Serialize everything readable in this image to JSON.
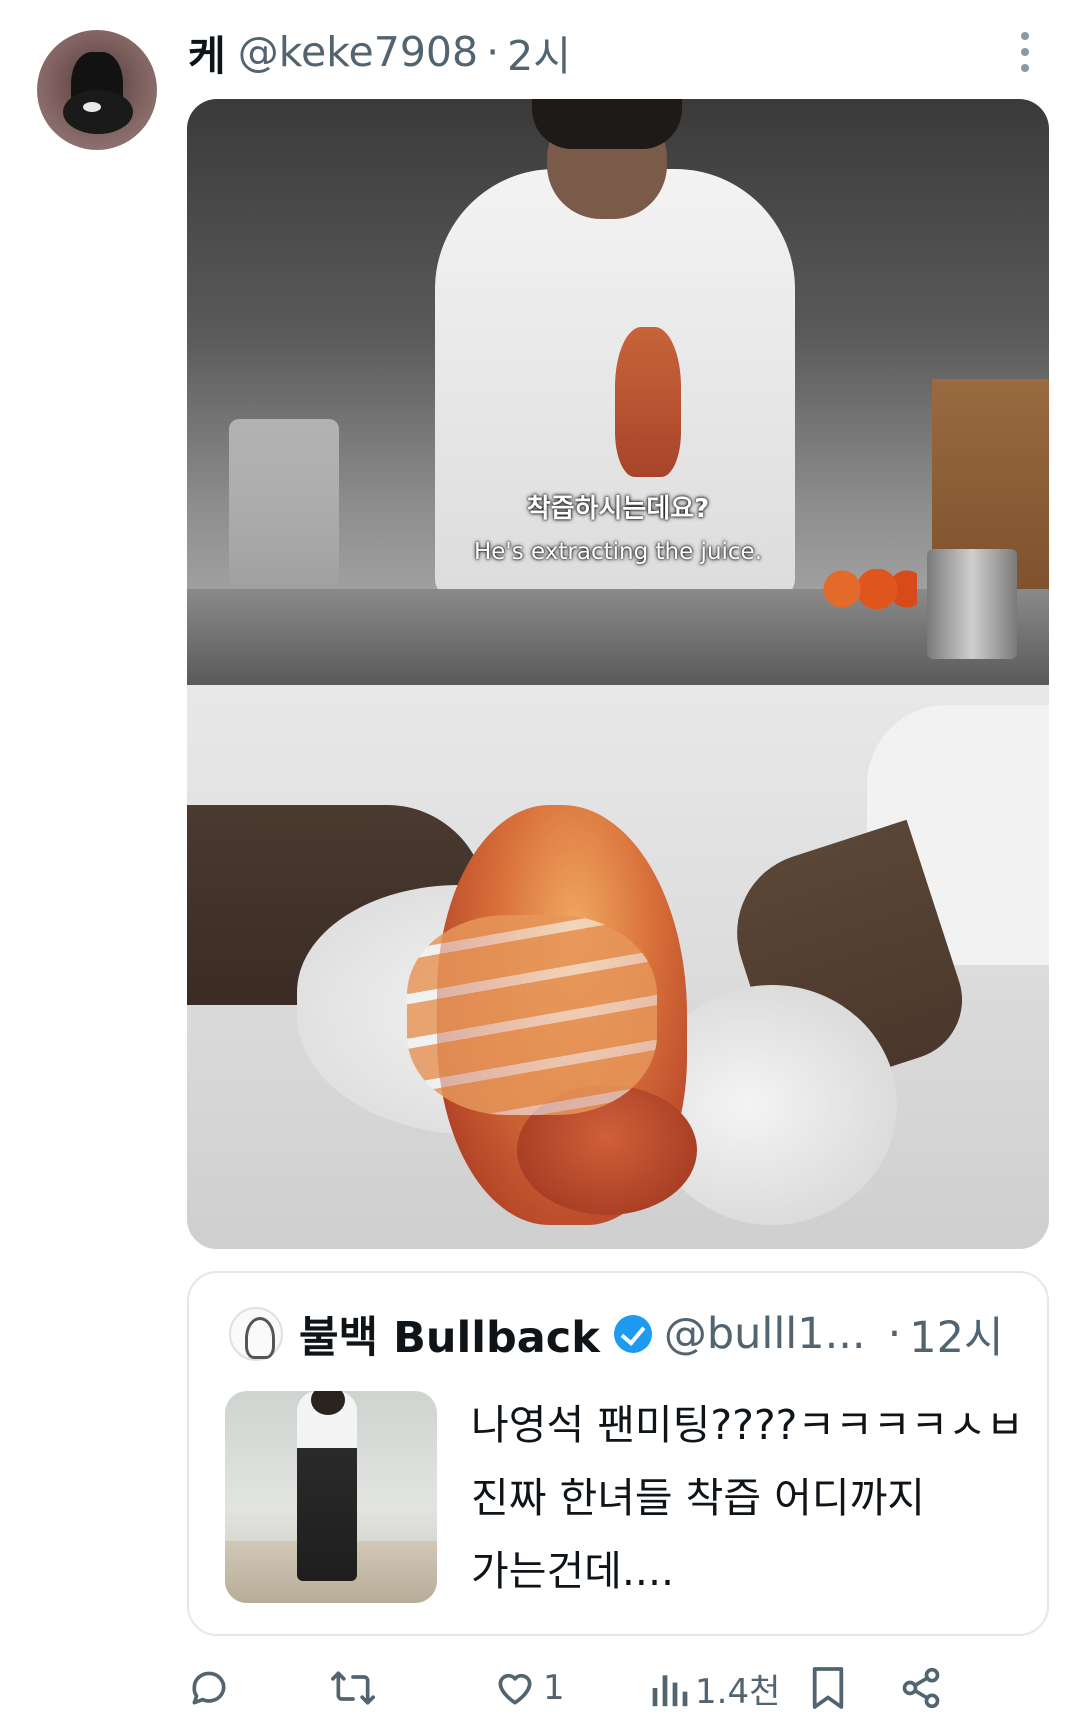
{
  "tweet": {
    "display_name": "케",
    "handle": "@keke7908",
    "separator": "·",
    "time": "2시",
    "avatar_icon": "avatar-image",
    "more_icon": "more-vertical-icon",
    "media": {
      "subtitle_ko": "착즙하시는데요?",
      "subtitle_en": "He's extracting the juice."
    }
  },
  "quote": {
    "display_name": "불백 Bullback",
    "verified_icon": "verified-badge-icon",
    "handle": "@bulll1...",
    "separator": "·",
    "time": "12시",
    "text": "나영석 팬미팅????ㅋㅋㅋㅋㅅㅂ\n진짜 한녀들 착즙 어디까지\n가는건데....",
    "accent_color": "#1d9bf0"
  },
  "actions": {
    "reply": {
      "icon": "reply-icon",
      "count": ""
    },
    "retweet": {
      "icon": "retweet-icon",
      "count": ""
    },
    "like": {
      "icon": "heart-icon",
      "count": "1"
    },
    "views": {
      "icon": "views-chart-icon",
      "count": "1.4천"
    },
    "bookmark": {
      "icon": "bookmark-icon",
      "count": ""
    },
    "share": {
      "icon": "share-icon",
      "count": ""
    }
  }
}
